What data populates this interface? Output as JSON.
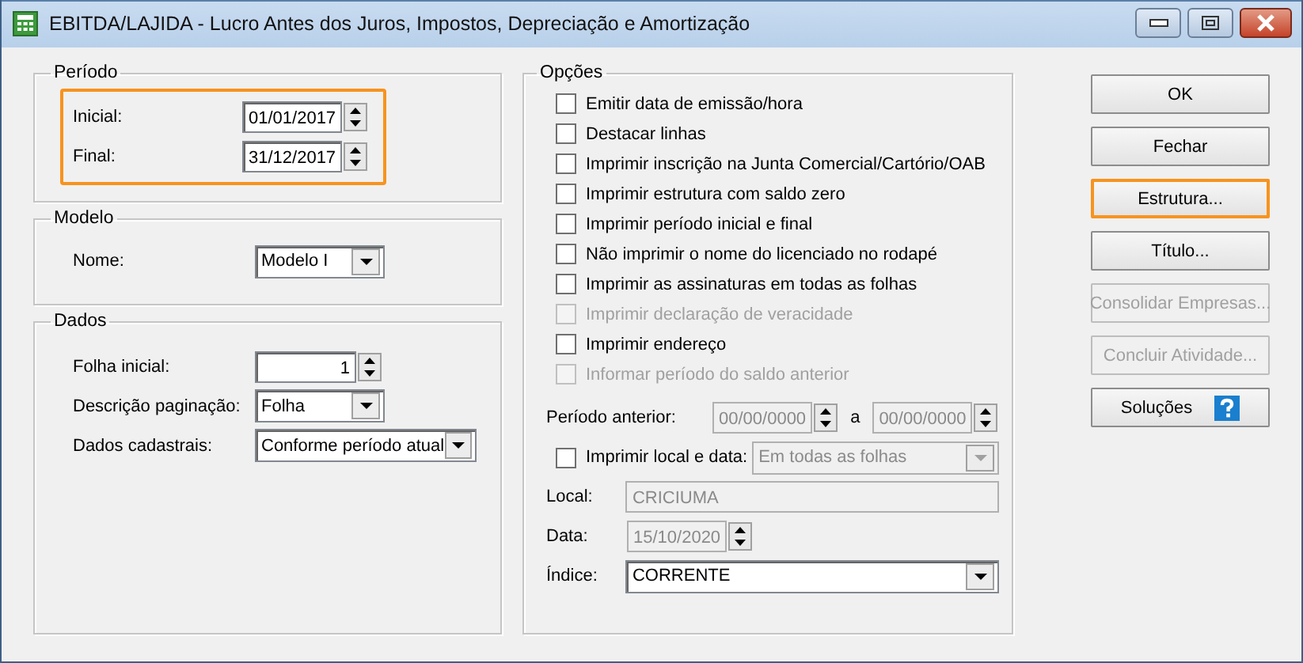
{
  "window": {
    "title": "EBITDA/LAJIDA - Lucro Antes dos Juros, Impostos, Depreciação e Amortização"
  },
  "periodo": {
    "title": "Período",
    "highlighted": true,
    "fields": [
      {
        "label": "Inicial:",
        "value": "01/01/2017"
      },
      {
        "label": "Final:",
        "value": "31/12/2017"
      }
    ]
  },
  "modelo": {
    "title": "Modelo",
    "fields": [
      {
        "label": "Nome:",
        "value": "Modelo I",
        "kind": "dropdown"
      }
    ]
  },
  "dados": {
    "title": "Dados",
    "fields": [
      {
        "label": "Folha inicial:",
        "value": "1",
        "kind": "spinner"
      },
      {
        "label": "Descrição paginação:",
        "value": "Folha",
        "kind": "dropdown"
      },
      {
        "label": "Dados cadastrais:",
        "value": "Conforme período atual",
        "kind": "dropdown"
      }
    ]
  },
  "opcoes": {
    "title": "Opções",
    "checkboxes": [
      {
        "label": "Emitir data de emissão/hora",
        "checked": false,
        "disabled": false
      },
      {
        "label": "Destacar linhas",
        "checked": false,
        "disabled": false
      },
      {
        "label": "Imprimir inscrição na Junta Comercial/Cartório/OAB",
        "checked": false,
        "disabled": false
      },
      {
        "label": "Imprimir estrutura com saldo zero",
        "checked": false,
        "disabled": false
      },
      {
        "label": "Imprimir período inicial e final",
        "checked": false,
        "disabled": false
      },
      {
        "label": "Não imprimir o nome do licenciado no rodapé",
        "checked": false,
        "disabled": false
      },
      {
        "label": "Imprimir as assinaturas em todas as folhas",
        "checked": false,
        "disabled": false
      },
      {
        "label": "Imprimir declaração de veracidade",
        "checked": false,
        "disabled": true
      },
      {
        "label": "Imprimir endereço",
        "checked": false,
        "disabled": false
      },
      {
        "label": "Informar período do saldo anterior",
        "checked": false,
        "disabled": true
      }
    ],
    "periodo_anterior": {
      "label": "Período anterior:",
      "from": "00/00/0000",
      "separator": "a",
      "to": "00/00/0000",
      "disabled": true
    },
    "local_data": {
      "label": "Imprimir local e data:",
      "checked": false,
      "value": "Em todas as folhas",
      "disabled": true
    },
    "local": {
      "label": "Local:",
      "value": "CRICIUMA",
      "disabled": true
    },
    "data": {
      "label": "Data:",
      "value": "15/10/2020",
      "disabled": true
    },
    "indice": {
      "label": "Índice:",
      "value": "CORRENTE",
      "disabled": false
    }
  },
  "buttons": [
    {
      "label": "OK",
      "kind": "plain",
      "disabled": false,
      "highlighted": false
    },
    {
      "label": "Fechar",
      "kind": "plain",
      "disabled": false,
      "highlighted": false
    },
    {
      "label": "Estrutura...",
      "kind": "plain",
      "disabled": false,
      "highlighted": true
    },
    {
      "label": "Título...",
      "kind": "plain",
      "disabled": false,
      "highlighted": false
    },
    {
      "label": "Consolidar Empresas...",
      "kind": "plain",
      "disabled": true,
      "highlighted": false
    },
    {
      "label": "Concluir Atividade...",
      "kind": "plain",
      "disabled": true,
      "highlighted": false
    },
    {
      "label": "Soluções",
      "kind": "help",
      "disabled": false,
      "highlighted": false
    }
  ]
}
